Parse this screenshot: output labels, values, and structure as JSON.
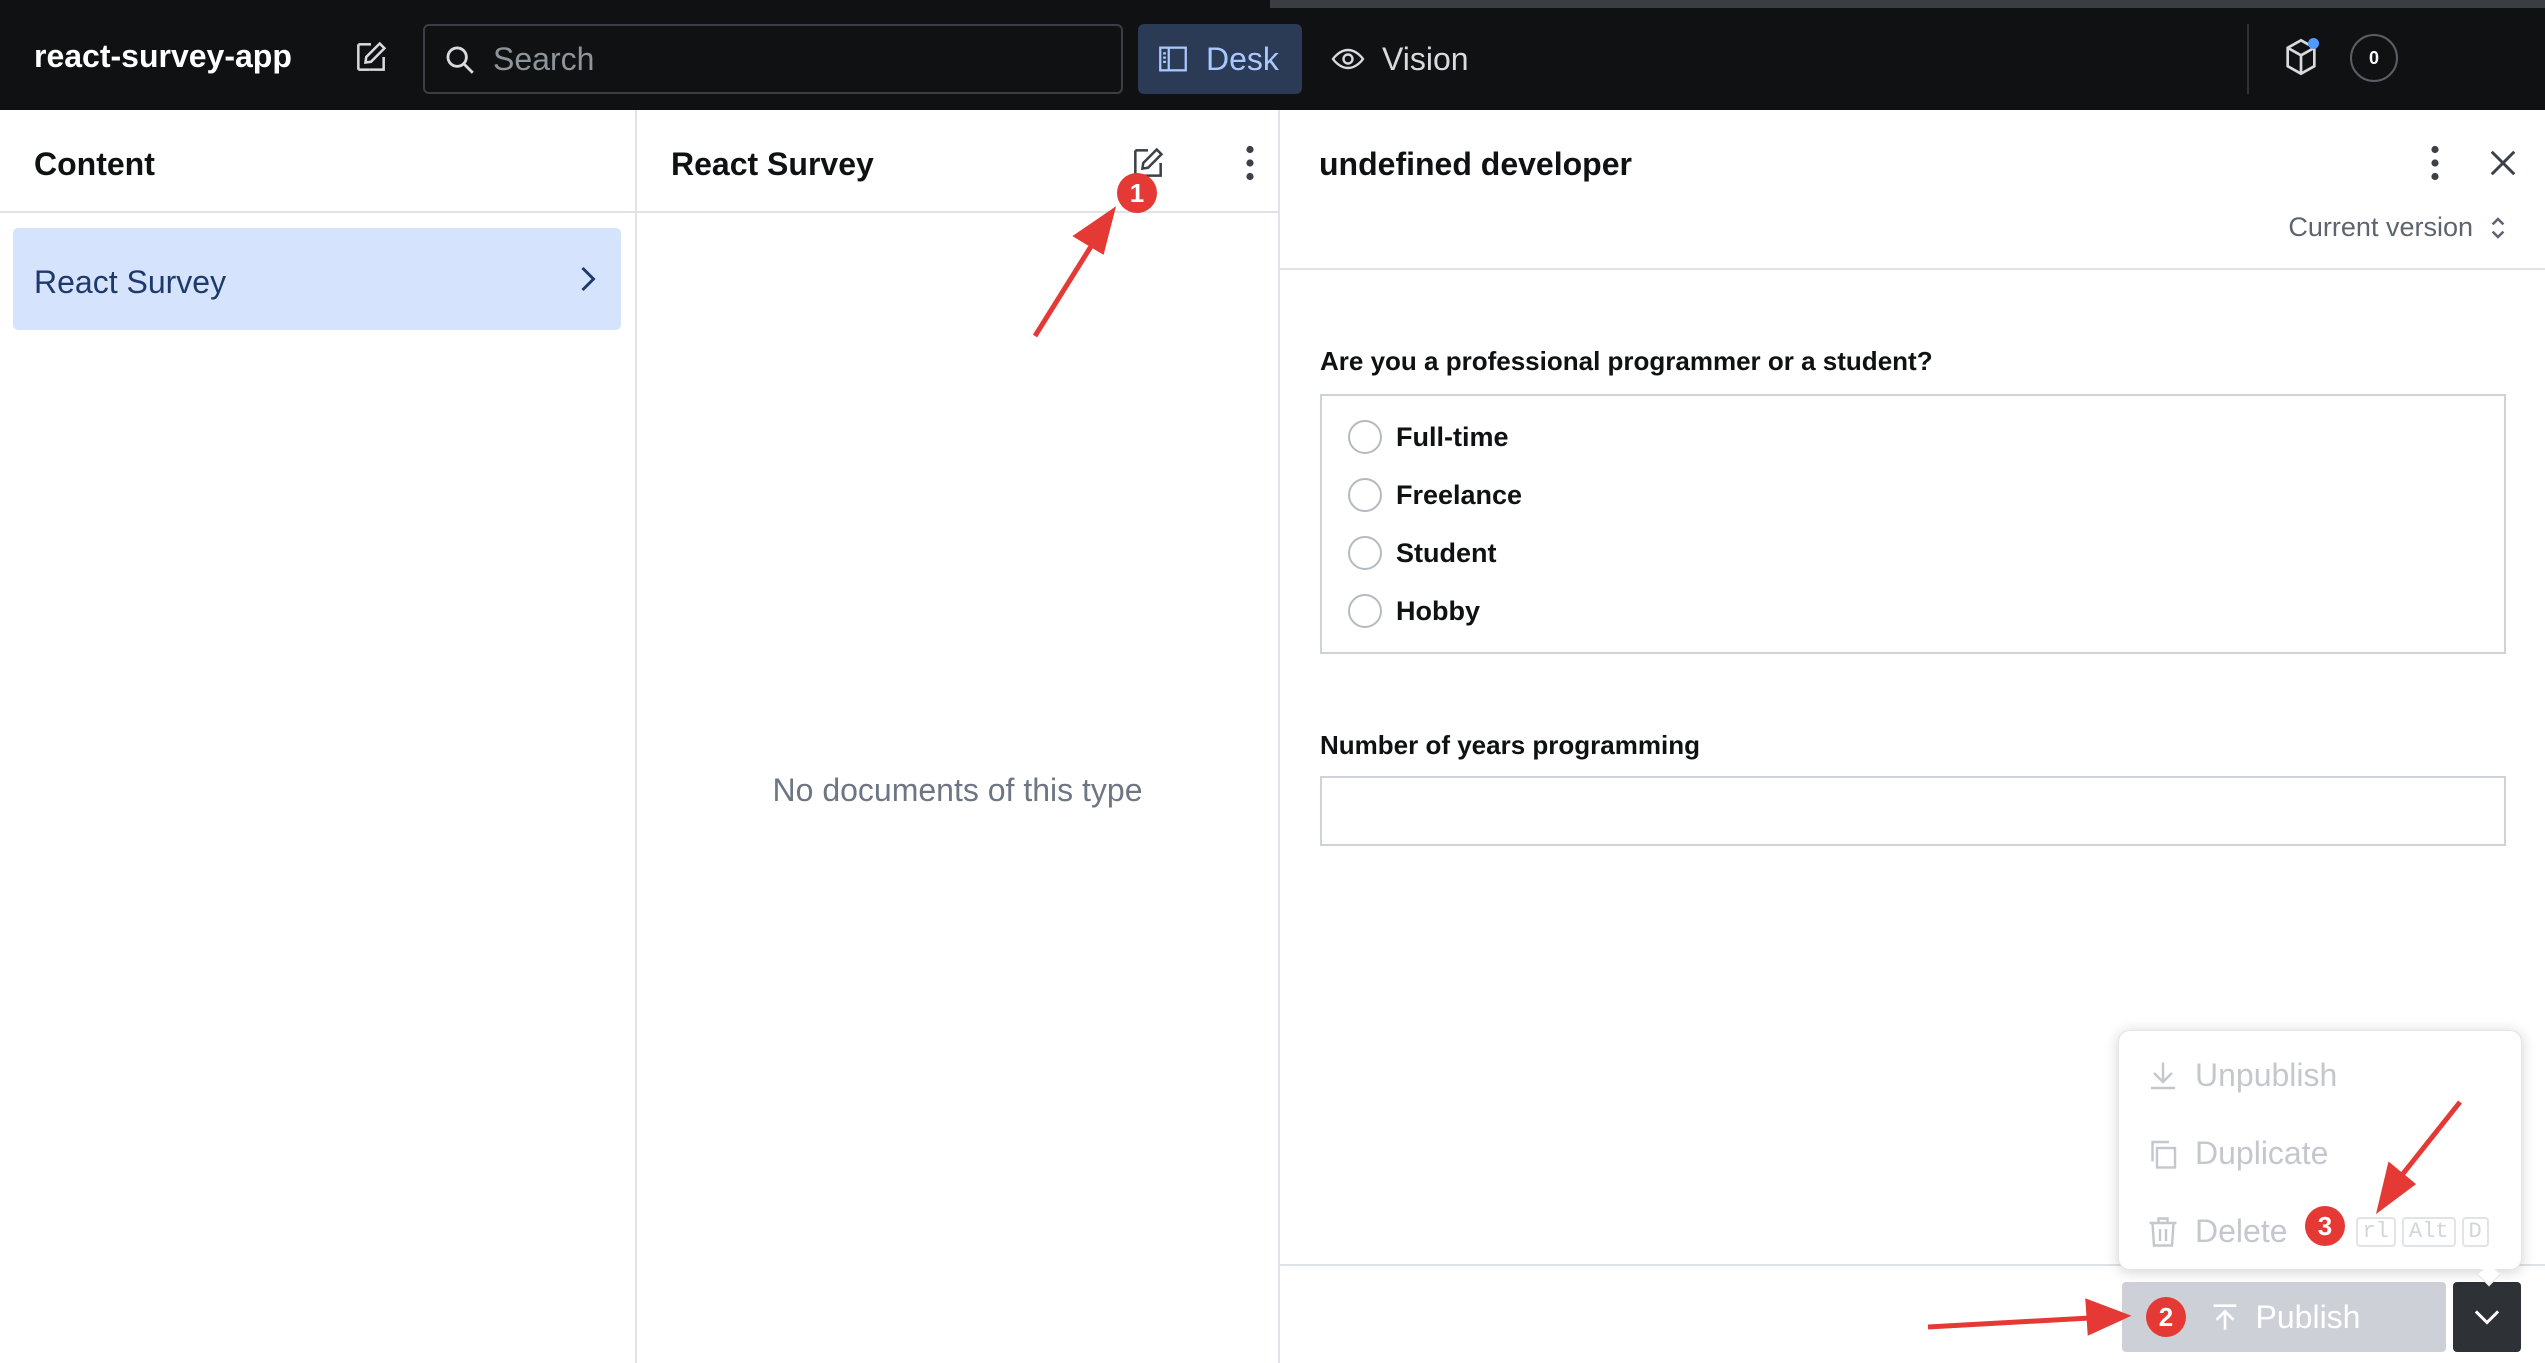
{
  "topbar": {
    "project_name": "react-survey-app",
    "search_placeholder": "Search",
    "tools": [
      {
        "label": "Desk",
        "icon": "desk-icon",
        "active": true
      },
      {
        "label": "Vision",
        "icon": "eye-icon",
        "active": false
      }
    ],
    "notification_count": "0",
    "colors": {
      "background": "#101112",
      "active_tool_bg": "#2b3a55",
      "active_tool_text": "#a9c8ff"
    }
  },
  "content_pane": {
    "title": "Content",
    "items": [
      {
        "label": "React Survey",
        "selected": true
      }
    ]
  },
  "list_pane": {
    "title": "React Survey",
    "empty_message": "No documents of this type"
  },
  "document_pane": {
    "title": "undefined developer",
    "version_label": "Current version",
    "fields": {
      "role": {
        "label": "Are you a professional programmer or a student?",
        "options": [
          "Full-time",
          "Freelance",
          "Student",
          "Hobby"
        ]
      },
      "years": {
        "label": "Number of years programming",
        "value": ""
      }
    },
    "publish_label": "Publish",
    "menu": {
      "unpublish": "Unpublish",
      "duplicate": "Duplicate",
      "delete": "Delete",
      "delete_shortcut": [
        "rl",
        "Alt",
        "D"
      ]
    }
  },
  "annotations": {
    "badge_1": "1",
    "badge_2": "2",
    "badge_3": "3",
    "color": "#e53935"
  }
}
